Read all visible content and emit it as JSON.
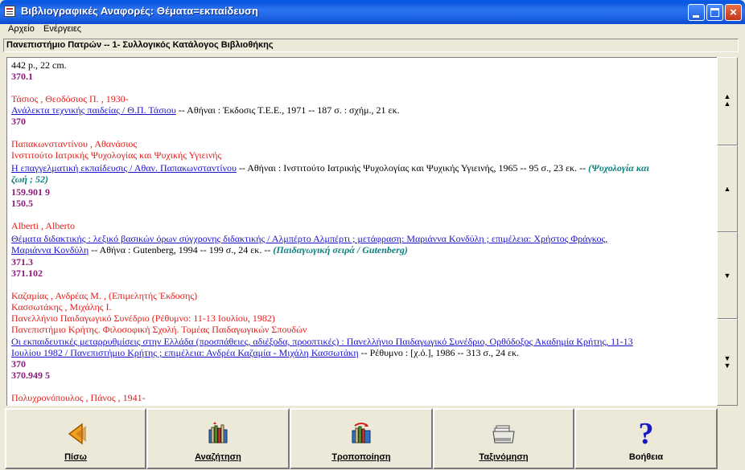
{
  "window": {
    "title": "Βιβλιογραφικές Αναφορές: Θέματα=εκπαίδευση",
    "minimize": "minimize",
    "maximize": "maximize",
    "close": "×"
  },
  "menu": {
    "file": "Αρχείο",
    "actions": "Ενέργειες"
  },
  "header": {
    "catalog": "Πανεπιστήμιο Πατρών -- 1- Συλλογικός Κατάλογος Βιβλιοθήκης"
  },
  "records": {
    "r0": {
      "desc": "442 p., 22 cm.",
      "code1": "370.1"
    },
    "r1": {
      "author": "Τάσιος , Θεοδόσιος Π. , 1930-",
      "title_link": "Ανάλεκτα τεχνικής παιδείας  / Θ.Π. Τάσιου",
      "pub": " -- Αθήναι  : Έκδοσις Τ.Ε.Ε., 1971 -- 187 σ.  : σχήμ., 21 εκ.",
      "code1": "370"
    },
    "r2": {
      "author": "Παπακωνσταντίνου , Αθανάσιος",
      "org": "Ινστιτούτο Ιατρικής Ψυχολογίας και Ψυχικής Υγιεινής",
      "title_link": "Η επαγγελματική εκπαίδευσις  / Αθαν. Παπακωνσταντίνου",
      "pub": " -- Αθήναι  : Ινστιτούτο Ιατρικής Ψυχολογίας και Ψυχικής Υγιεινής, 1965 -- 95 σ., 23 εκ. -- ",
      "series_a": "(Ψυχολογία και",
      "series_b": "ζωή ; 52)",
      "code1": "159.901 9",
      "code2": "150.5"
    },
    "r3": {
      "author": "Alberti , Alberto",
      "title_link_a": "Θέματα διδακτικής  : λεξικό βασικών όρων σύγχρονης διδακτικής  / Αλμπέρτο Αλμπέρτι ; μετάφραση: Μαριάννα Κονδύλη ; επιμέλεια: Χρήστος Φράγκος,",
      "title_link_b": "Μαριάννα Κονδύλη",
      "pub": " -- Αθήνα  : Gutenberg, 1994 -- 199 σ., 24 εκ. -- ",
      "series": "(Παιδαγωγική σειρά  / Gutenberg)",
      "code1": "371.3",
      "code2": "371.102"
    },
    "r4": {
      "author1": "Καζαμίας , Ανδρέας Μ. , (Επιμελητής Έκδοσης)",
      "author2": "Κασσωτάκης , Μιχάλης Ι.",
      "conf": "Πανελλήνιο Παιδαγωγικό Συνέδριο (Ρέθυμνο: 11-13 Ιουλίου, 1982)",
      "org": "Πανεπιστήμιο Κρήτης. Φιλοσοφική Σχολή. Τομέας Παιδαγωγικών Σπουδών",
      "title_link_a": "Οι εκπαιδευτικές μεταρρυθμίσεις στην Ελλάδα (προσπάθειες, αδιέξοδα, προοπτικές)  : Πανελλήνιο Παιδαγωγικό Συνέδριο, Ορθόδοξος Ακαδημία Κρήτης, 11-13",
      "title_link_b": "Ιουλίου 1982  / Πανεπιστήμιο Κρήτης ; επιμέλεια: Ανδρέα Καζαμία - Μιχάλη Κασσωτάκη",
      "pub": " -- Ρέθυμνο  : [χ.ό.], 1986 -- 313 σ., 24 εκ.",
      "code1": "370",
      "code2": "370.949 5"
    },
    "r5": {
      "author": "Πολυχρονόπουλος , Πάνος , 1941-"
    }
  },
  "scrollbar": {
    "top": "▲\n▲",
    "up": "▲",
    "down": "▼",
    "bottom": "▼\n▼"
  },
  "toolbar": {
    "back": "Πίσω",
    "search": "Αναζήτηση",
    "modify": "Τροποποίηση",
    "sort": "Ταξινόμηση",
    "help": "Βοήθεια",
    "help_glyph": "?"
  },
  "colors": {
    "author": "#e0201c",
    "link": "#1a12cc",
    "code": "#8b1a7a",
    "series": "#0d8080"
  }
}
